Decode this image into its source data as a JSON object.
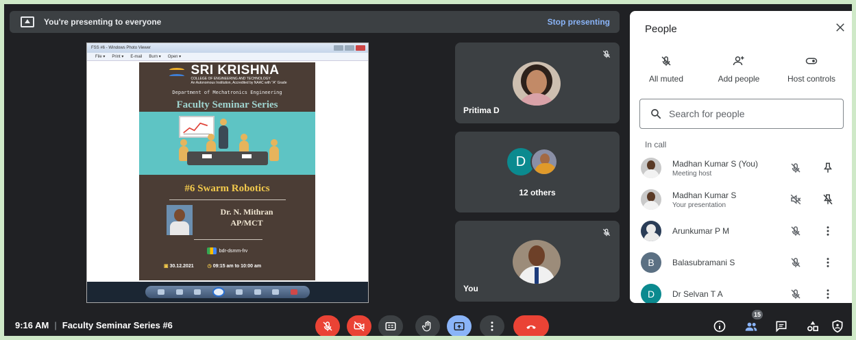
{
  "presenting": {
    "message": "You're presenting to everyone",
    "stop_label": "Stop presenting"
  },
  "photo_viewer": {
    "window_title": "FSS #6 - Windows Photo Viewer",
    "menu": [
      "File ▾",
      "Print ▾",
      "E-mail",
      "Burn ▾",
      "Open ▾"
    ]
  },
  "poster": {
    "brand": "SRI KRISHNA",
    "college": "COLLEGE OF ENGINEERING AND TECHNOLOGY",
    "accreditation": "An Autonomous Institution, Accredited by NAAC with \"A\" Grade",
    "department": "Department of Mechatronics Engineering",
    "series": "Faculty Seminar Series",
    "topic": "#6 Swarm Robotics",
    "speaker_name": "Dr. N. Mithran",
    "speaker_title": "AP/MCT",
    "meet_code": "bdr-dsmm-frv",
    "date": "30.12.2021",
    "time": "09:15 am to 10:00 am"
  },
  "tiles": [
    {
      "name": "Pritima D",
      "muted": true
    },
    {
      "letter": "D",
      "label": "12 others"
    },
    {
      "name": "You",
      "muted": true
    }
  ],
  "bottom_bar": {
    "time": "9:16 AM",
    "meeting_title": "Faculty Seminar Series #6",
    "participant_count": "15"
  },
  "people_panel": {
    "title": "People",
    "actions": [
      "All muted",
      "Add people",
      "Host controls"
    ],
    "search_placeholder": "Search for people",
    "section_label": "In call",
    "participants": [
      {
        "name": "Madhan Kumar S (You)",
        "sub": "Meeting host"
      },
      {
        "name": "Madhan Kumar S",
        "sub": "Your presentation"
      },
      {
        "name": "Arunkumar P M",
        "sub": ""
      },
      {
        "name": "Balasubramani S",
        "sub": "",
        "letter": "B",
        "color": "#5b7083"
      },
      {
        "name": "Dr Selvan T A",
        "sub": "",
        "letter": "D",
        "color": "#0b8a8f"
      }
    ]
  },
  "colors": {
    "background": "#202124",
    "tile": "#3c4043",
    "accent": "#8ab4f8",
    "danger": "#ea4335"
  }
}
